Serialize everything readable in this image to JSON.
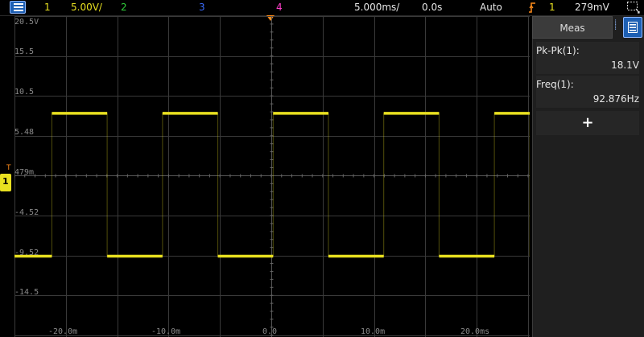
{
  "topbar": {
    "ch1_num": "1",
    "ch1_scale": "5.00V/",
    "ch2_num": "2",
    "ch3_num": "3",
    "ch4_num": "4",
    "timebase": "5.000ms/",
    "delay": "0.0s",
    "trigger_mode": "Auto",
    "trigger_source": "1",
    "trigger_level": "279mV"
  },
  "colors": {
    "ch1": "#e8e020",
    "ch2": "#2fcf3a",
    "ch3": "#3a6cff",
    "ch4": "#ff3fc9",
    "trigger": "#ff8c1a",
    "grid": "#3a3a3a"
  },
  "y_axis_labels": [
    "20.5V",
    "15.5",
    "10.5",
    "5.48",
    "479m",
    "-4.52",
    "-9.52",
    "-14.5"
  ],
  "x_axis_labels": [
    "-20.0m",
    "-10.0m",
    "0.0",
    "10.0m",
    "20.0ms"
  ],
  "channel_marker": "1",
  "trigger_marker_label": "T",
  "meas_panel": {
    "tab_label": "Meas",
    "items": [
      {
        "label": "Pk-Pk(1):",
        "value": "18.1V"
      },
      {
        "label": "Freq(1):",
        "value": "92.876Hz"
      }
    ],
    "add_label": "+"
  },
  "waveform": {
    "type": "square",
    "channel": "1",
    "high_v": 8.3,
    "low_v": -9.6,
    "period_ms": 10.77,
    "first_rise_ms": -21.4
  },
  "icons": [
    "menu-icon",
    "trigger-edge-icon",
    "snapshot-icon",
    "measure-icon"
  ]
}
